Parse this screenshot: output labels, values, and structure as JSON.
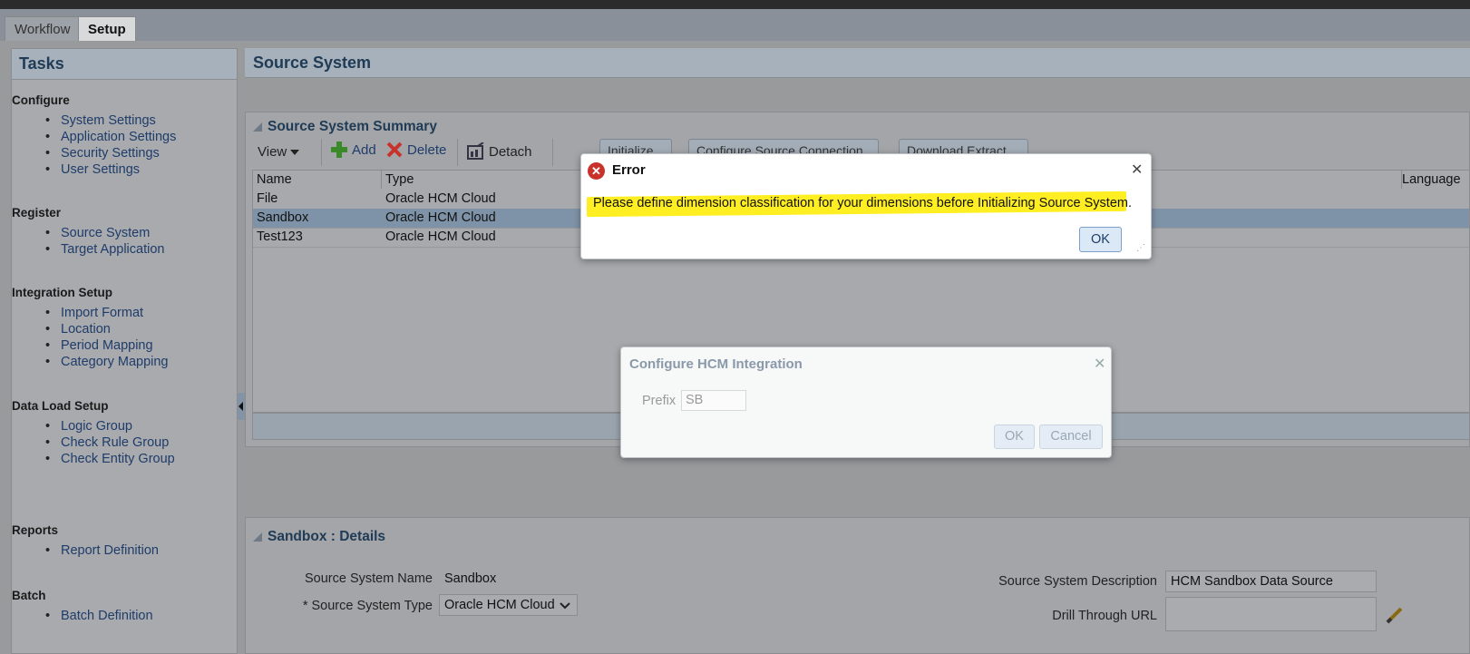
{
  "tabs": [
    {
      "label": "Workflow"
    },
    {
      "label": "Setup"
    }
  ],
  "tasks": {
    "title": "Tasks",
    "sections": [
      {
        "title": "Configure",
        "items": [
          "System Settings",
          "Application Settings",
          "Security Settings",
          "User Settings"
        ]
      },
      {
        "title": "Register",
        "items": [
          "Source System",
          "Target Application"
        ]
      },
      {
        "title": "Integration Setup",
        "items": [
          "Import Format",
          "Location",
          "Period Mapping",
          "Category Mapping"
        ]
      },
      {
        "title": "Data Load Setup",
        "items": [
          "Logic Group",
          "Check Rule Group",
          "Check Entity Group"
        ]
      },
      {
        "title": "Reports",
        "items": [
          "Report Definition"
        ]
      },
      {
        "title": "Batch",
        "items": [
          "Batch Definition"
        ]
      }
    ]
  },
  "source_system": {
    "title": "Source System",
    "summary_title": "Source System Summary",
    "toolbar": {
      "view": "View",
      "add": "Add",
      "delete": "Delete",
      "detach": "Detach",
      "initialize": "Initialize",
      "configure": "Configure Source Connection",
      "download": "Download Extract"
    },
    "columns": [
      "Name",
      "Type",
      "Language"
    ],
    "rows": [
      {
        "name": "File",
        "type": "Oracle HCM Cloud"
      },
      {
        "name": "Sandbox",
        "type": "Oracle HCM Cloud"
      },
      {
        "name": "Test123",
        "type": "Oracle HCM Cloud"
      }
    ]
  },
  "details": {
    "title": "Sandbox : Details",
    "name_label": "Source System Name",
    "name_value": "Sandbox",
    "type_label": "* Source System Type",
    "type_value": "Oracle HCM Cloud",
    "desc_label": "Source System Description",
    "desc_value": "HCM Sandbox Data Source",
    "drill_label": "Drill Through URL",
    "drill_value": ""
  },
  "error_dialog": {
    "title": "Error",
    "message": "Please define dimension classification for your dimensions before Initializing Source System.",
    "ok": "OK",
    "icon": "error-icon"
  },
  "hcm_dialog": {
    "title": "Configure HCM Integration",
    "prefix_label": "Prefix",
    "prefix_value": "SB",
    "ok": "OK",
    "cancel": "Cancel"
  },
  "colors": {
    "highlight": "#ffee22",
    "header_text": "#1f3b55",
    "link": "#1f3c6a",
    "error_icon": "#c8322b"
  }
}
